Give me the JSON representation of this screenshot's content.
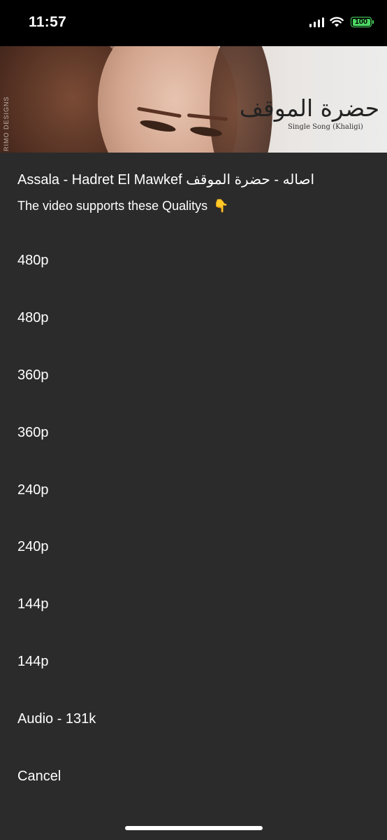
{
  "status_bar": {
    "time": "11:57",
    "battery": "100",
    "icons": [
      "signal-icon",
      "wifi-icon",
      "battery-icon"
    ]
  },
  "thumbnail": {
    "title_arabic": "حضرة الموقف",
    "subtitle": "Single Song (Khaligi)",
    "watermark": "RIMO DESIGNS"
  },
  "sheet": {
    "title": "Assala - Hadret El Mawkef   اصاله - حضرة الموقف",
    "message": "The video supports these Qualitys",
    "message_icon": "👇",
    "options": [
      {
        "label": "480p"
      },
      {
        "label": "480p"
      },
      {
        "label": "360p"
      },
      {
        "label": "360p"
      },
      {
        "label": "240p"
      },
      {
        "label": "240p"
      },
      {
        "label": "144p"
      },
      {
        "label": "144p"
      },
      {
        "label": "Audio - 131k"
      },
      {
        "label": "Cancel"
      }
    ]
  },
  "colors": {
    "sheet_background": "#2b2b2b",
    "status_background": "#000000",
    "battery": "#4cd964",
    "text": "#ffffff"
  }
}
